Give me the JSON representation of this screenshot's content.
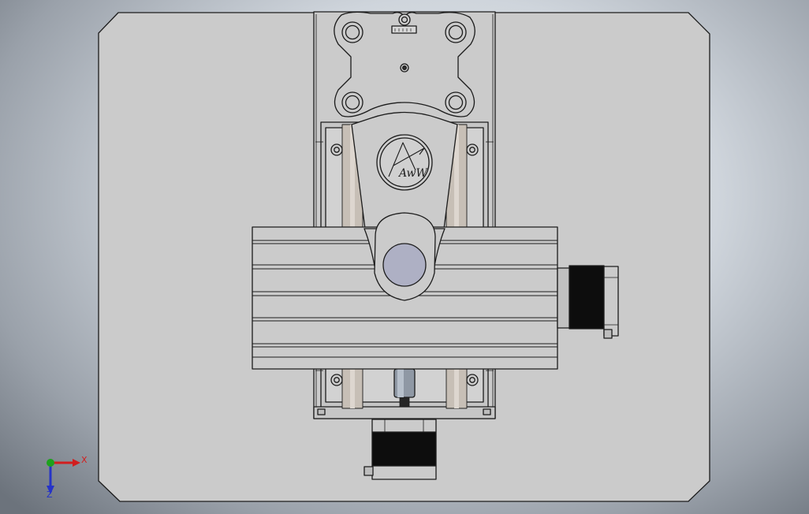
{
  "viewport": {
    "background_colors": [
      "#e3e7ec",
      "#cfd5dc",
      "#9aa1aa",
      "#6c737c"
    ]
  },
  "model": {
    "part_fill": "#cbcbcb",
    "edge_color": "#1c1c1c",
    "rod_color": "#c7bfb6",
    "motor_color": "#0d0d0d",
    "spindle_window_color": "#aeb0c4",
    "logo_text": "AwW"
  },
  "triad": {
    "x_label": "X",
    "z_label": "Z",
    "x_color": "#d21e1e",
    "y_color": "#1da21d",
    "z_color": "#2533c8"
  }
}
